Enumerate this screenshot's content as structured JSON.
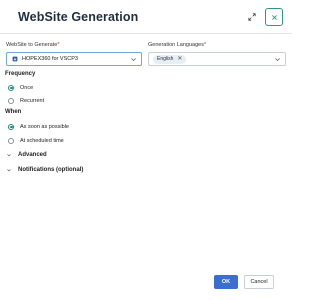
{
  "dialog": {
    "title": "WebSite Generation",
    "expand_icon": "expand-icon",
    "close_icon": "close-icon",
    "accent_color": "#1a8a78"
  },
  "website": {
    "label": "WebSite to Generate",
    "required_mark": "*",
    "value": "HOPEX360 for VSCP3",
    "icon": "website-icon"
  },
  "languages": {
    "label": "Generation Languages",
    "required_mark": "*",
    "chips": [
      "English"
    ]
  },
  "frequency": {
    "title": "Frequency",
    "options": [
      "Once",
      "Recurrent"
    ],
    "selected": "Once"
  },
  "when": {
    "title": "When",
    "options": [
      "As soon as possible",
      "At scheduled time"
    ],
    "selected": "As soon as possible"
  },
  "sections": {
    "advanced": "Advanced",
    "notifications": "Notifications (optional)"
  },
  "footer": {
    "ok_label": "OK",
    "cancel_label": "Cancel",
    "ok_color": "#3a6ed0"
  }
}
